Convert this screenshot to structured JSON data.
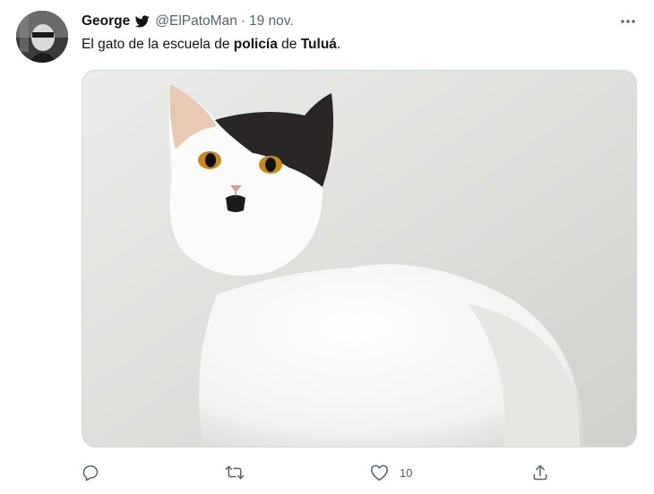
{
  "tweet": {
    "author_name": "George",
    "author_handle": "@ElPatoMan",
    "separator": "·",
    "timestamp": "19 nov.",
    "text_parts": [
      "El gato de la escuela de ",
      "policía",
      " de ",
      "Tuluá",
      "."
    ],
    "media_description": "photo",
    "like_count": "10"
  },
  "icons": {
    "author_badge": "bird-icon",
    "more": "more-icon",
    "reply": "reply-icon",
    "retweet": "retweet-icon",
    "like": "heart-icon",
    "share": "share-icon"
  },
  "colors": {
    "text": "#0f1419",
    "secondary": "#536471",
    "border": "#cfd9de"
  }
}
